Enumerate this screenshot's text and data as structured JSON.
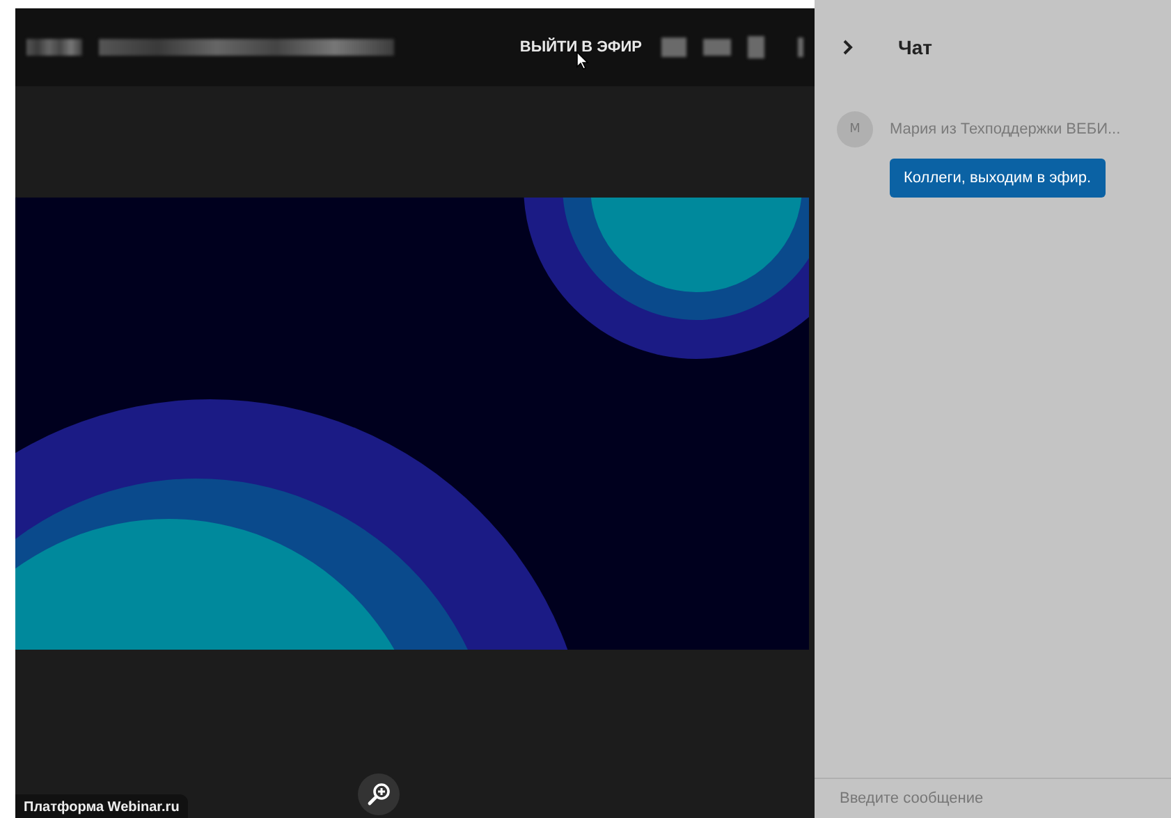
{
  "header": {
    "go_live_button": "ВЫЙТИ В ЭФИР"
  },
  "chat": {
    "title": "Чат",
    "messages": [
      {
        "avatar": "М",
        "author": "Мария из Техподдержки ВЕБИ...",
        "text": "Коллеги, выходим в эфир."
      }
    ],
    "input": {
      "placeholder": "Введите сообщение"
    }
  },
  "footer": {
    "platform_label": "Платформа Webinar.ru"
  }
}
